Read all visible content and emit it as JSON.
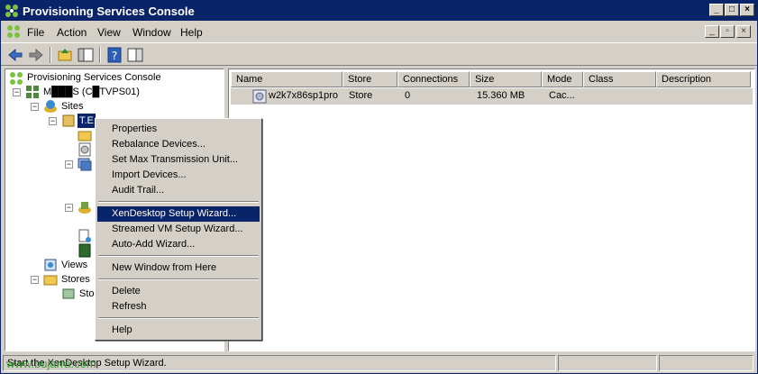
{
  "window": {
    "title": "Provisioning Services Console"
  },
  "menubar": {
    "items": [
      "File",
      "Action",
      "View",
      "Window",
      "Help"
    ]
  },
  "tree": {
    "root": "Provisioning Services Console",
    "server": "M███S (C█TVPS01)",
    "sites": "Sites",
    "site_selected": "T.E",
    "views": "Views",
    "stores": "Stores",
    "store_child": "Sto"
  },
  "list": {
    "columns": [
      "Name",
      "Store",
      "Connections",
      "Size",
      "Mode",
      "Class",
      "Description"
    ],
    "rows": [
      {
        "name": "w2k7x86sp1pro",
        "store": "Store",
        "connections": "0",
        "size": "15.360 MB",
        "mode": "Cac...",
        "class": "",
        "description": ""
      }
    ]
  },
  "context_menu": {
    "items": [
      "Properties",
      "Rebalance Devices...",
      "Set Max Transmission Unit...",
      "Import Devices...",
      "Audit Trail...",
      "XenDesktop Setup Wizard...",
      "Streamed VM Setup Wizard...",
      "Auto-Add Wizard...",
      "New Window from Here",
      "Delete",
      "Refresh",
      "Help"
    ],
    "highlighted": "XenDesktop Setup Wizard..."
  },
  "statusbar": {
    "text": "Start the XenDesktop Setup Wizard.",
    "watermark": "www.bujarra.com"
  },
  "colors": {
    "title_bg": "#0a246a",
    "chrome": "#d4d0c8",
    "highlight": "#0a246a",
    "watermark": "#2e9a2e"
  }
}
